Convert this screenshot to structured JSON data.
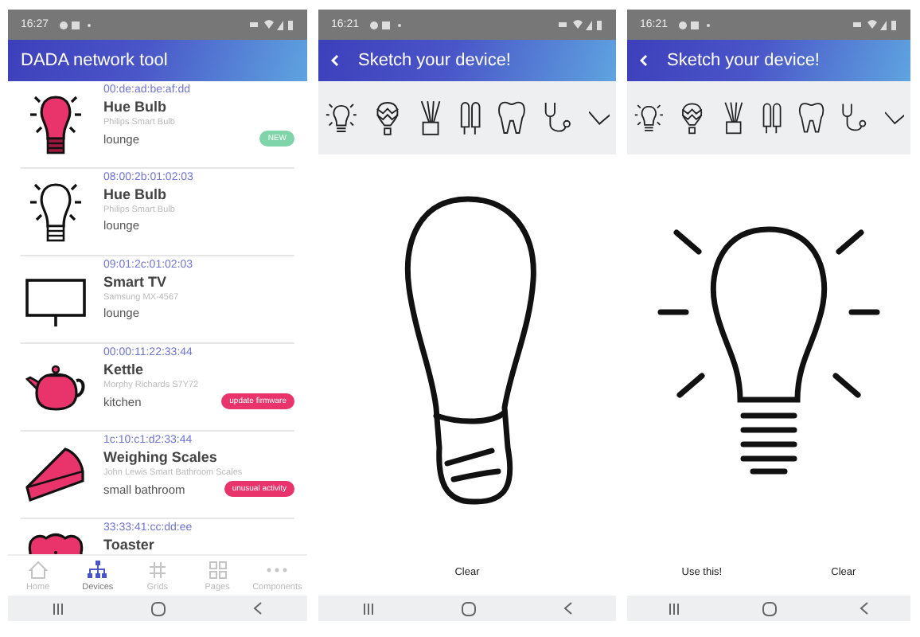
{
  "phones": [
    {
      "kind": "list",
      "status_time": "16:27",
      "title": "DADA network tool",
      "devices": [
        {
          "kind": "bulb",
          "filled": true,
          "mac": "00:de:ad:be:af:dd",
          "name": "Hue Bulb",
          "model": "Philips Smart Bulb",
          "room": "lounge",
          "badge": {
            "label": "NEW",
            "color": "#7fd4a9"
          }
        },
        {
          "kind": "bulb",
          "filled": false,
          "mac": "08:00:2b:01:02:03",
          "name": "Hue Bulb",
          "model": "Philips Smart Bulb",
          "room": "lounge"
        },
        {
          "kind": "tv",
          "filled": false,
          "mac": "09:01:2c:01:02:03",
          "name": "Smart TV",
          "model": "Samsung MX-4567",
          "room": "lounge"
        },
        {
          "kind": "teapot",
          "filled": true,
          "mac": "00:00:11:22:33:44",
          "name": "Kettle",
          "model": "Morphy Richards S7Y72",
          "room": "kitchen",
          "badge": {
            "label": "update firmware",
            "color": "#e8336b"
          }
        },
        {
          "kind": "pie",
          "filled": true,
          "mac": "1c:10:c1:d2:33:44",
          "name": "Weighing Scales",
          "model": "John Lewis Smart Bathroom Scales",
          "room": "small bathroom",
          "badge": {
            "label": "unusual activity",
            "color": "#e8336b"
          }
        },
        {
          "kind": "bread",
          "filled": true,
          "mac": "33:33:41:cc:dd:ee",
          "name": "Toaster"
        }
      ],
      "tabs": [
        {
          "label": "Home",
          "selected": false
        },
        {
          "label": "Devices",
          "selected": true
        },
        {
          "label": "Grids",
          "selected": false
        },
        {
          "label": "Pages",
          "selected": false
        },
        {
          "label": "Components",
          "selected": false
        }
      ]
    },
    {
      "kind": "freehand",
      "status_time": "16:21",
      "title": "Sketch your device!",
      "buttons": [
        "Clear"
      ]
    },
    {
      "kind": "suggestion",
      "status_time": "16:21",
      "title": "Sketch your device!",
      "buttons": [
        "Use this!",
        "Clear"
      ]
    }
  ]
}
